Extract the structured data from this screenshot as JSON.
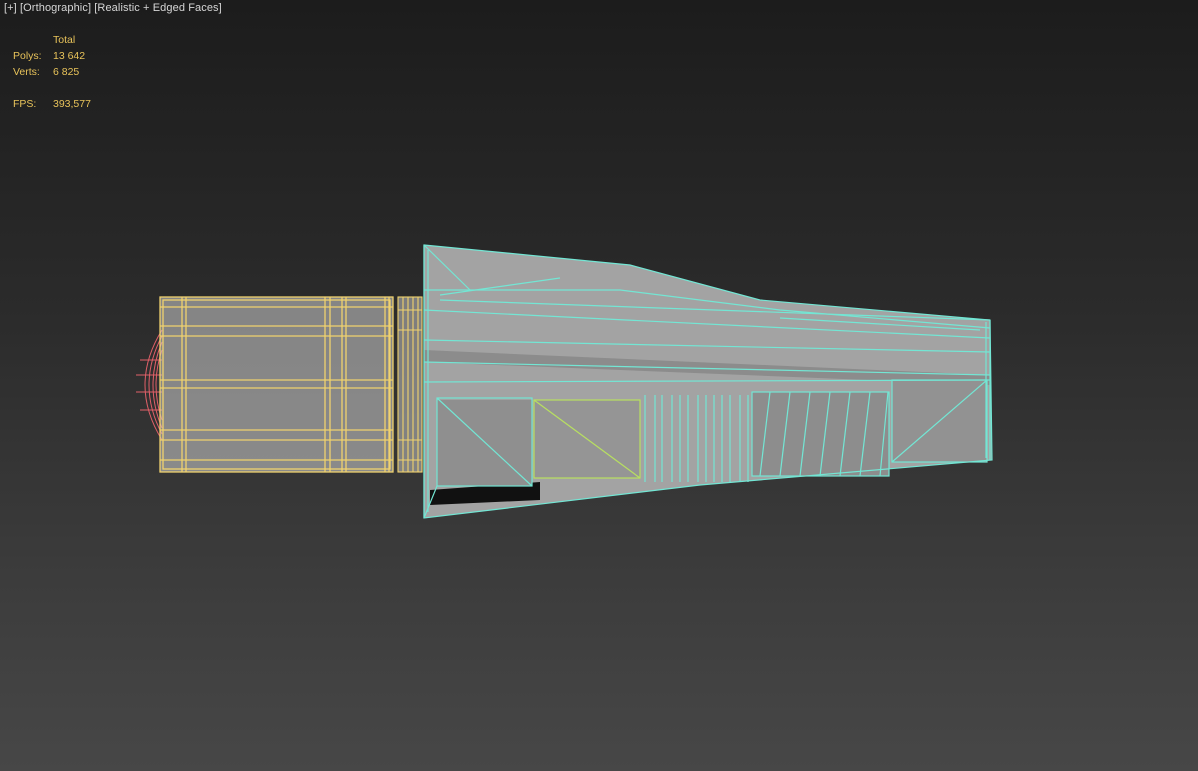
{
  "viewport": {
    "label_parts": [
      "[+]",
      "[Orthographic]",
      "[Realistic + Edged Faces]"
    ]
  },
  "stats": {
    "column_header": "Total",
    "polys_label": "Polys:",
    "polys_value": "13 642",
    "verts_label": "Verts:",
    "verts_value": "6 825",
    "fps_label": "FPS:",
    "fps_value": "393,577"
  },
  "colors": {
    "stats_text": "#e8c35a",
    "selected_wire": "#73e6d4",
    "unselected_wire": "#f0d26e",
    "sphere_wire": "#e06068",
    "inner_panel_wire": "#b8e060",
    "mesh_face": "#9c9c9c"
  }
}
